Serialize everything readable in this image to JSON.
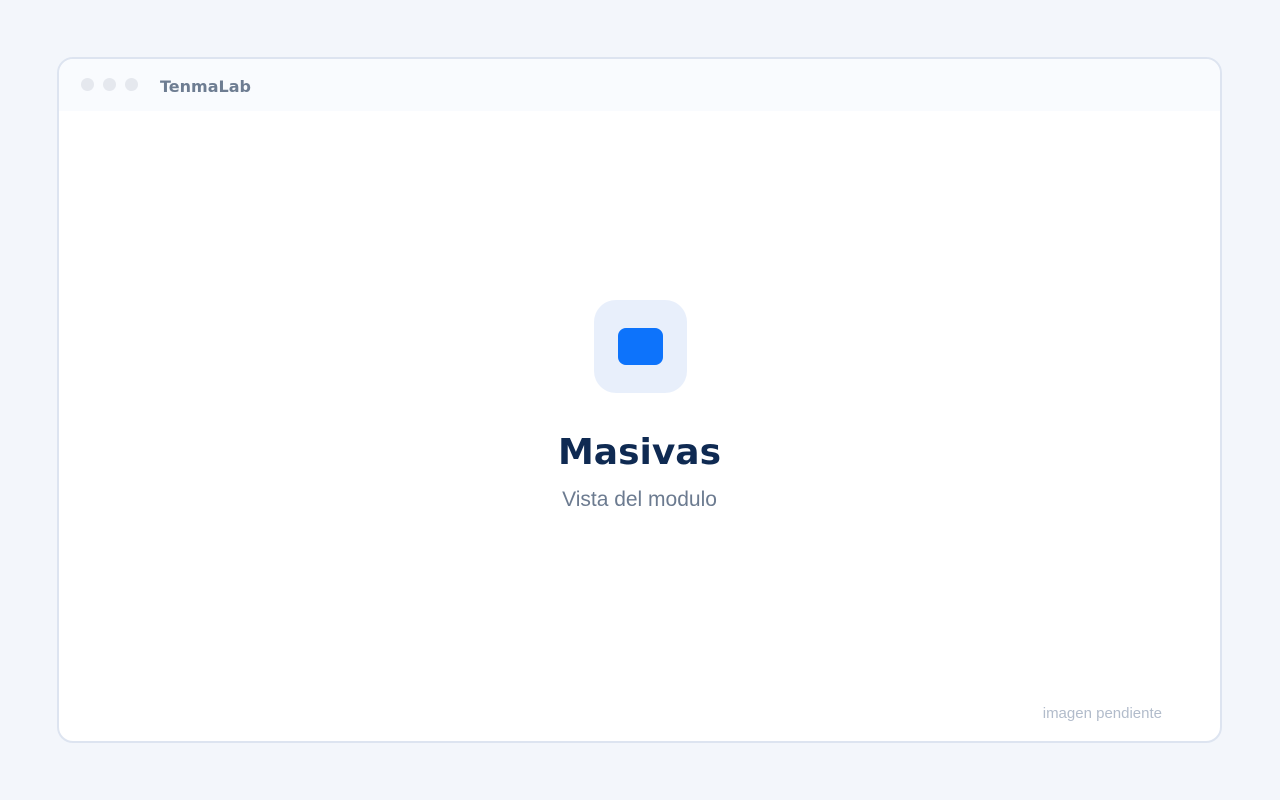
{
  "window": {
    "title": "TenmaLab",
    "controls": [
      "close",
      "minimize",
      "maximize"
    ]
  },
  "main": {
    "icon": "module-icon",
    "title": "Masivas",
    "subtitle": "Vista del modulo",
    "status_note": "imagen pendiente"
  },
  "colors": {
    "page_background": "#f3f6fb",
    "accent": "#0d73fb",
    "icon_background": "#e8effb",
    "title_text": "#0f2a52",
    "muted_text": "#6c7b90",
    "note_text": "#b2bccb"
  }
}
